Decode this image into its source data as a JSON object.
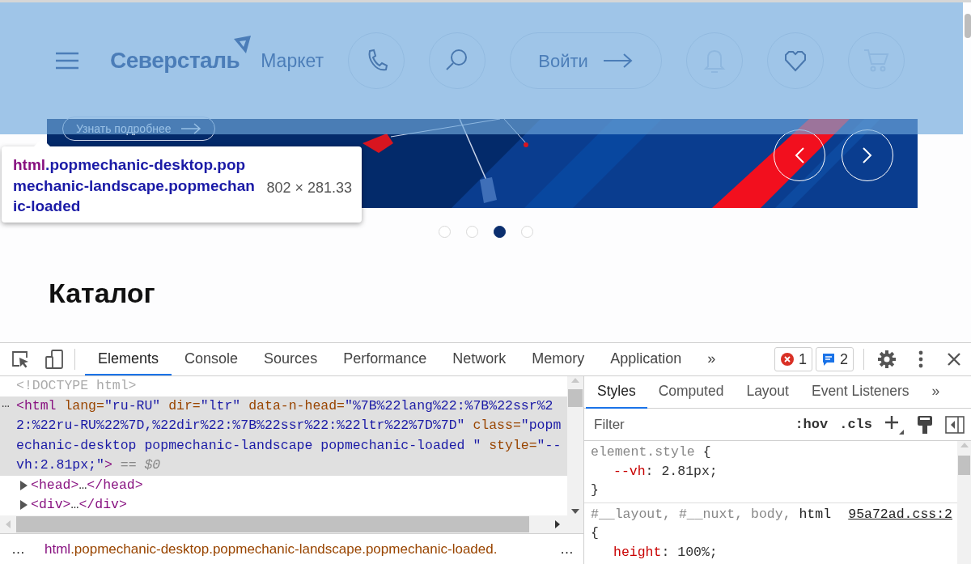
{
  "page": {
    "header": {
      "brand": "Северсталь",
      "product": "Маркет",
      "actions": [
        {
          "kind": "phone",
          "disabled": false
        },
        {
          "kind": "search",
          "disabled": false
        },
        {
          "kind": "login",
          "label": "Войти",
          "disabled": false
        },
        {
          "kind": "bell",
          "disabled": true
        },
        {
          "kind": "heart",
          "disabled": false
        },
        {
          "kind": "cart",
          "disabled": true
        }
      ]
    },
    "banner": {
      "more_button": "Узнать подробнее",
      "dots": [
        {
          "selected": false
        },
        {
          "selected": false
        },
        {
          "selected": true
        },
        {
          "selected": false
        }
      ]
    },
    "catalog_heading": "Каталог",
    "highlight_tooltip": {
      "tag": "html",
      "classes": ".popmechanic-desktop.popmechanic-landscape.popmechanic-loaded",
      "size": "802 × 281.33"
    }
  },
  "devtools": {
    "tabs": [
      {
        "label": "Elements",
        "selected": true
      },
      {
        "label": "Console",
        "selected": false
      },
      {
        "label": "Sources",
        "selected": false
      },
      {
        "label": "Performance",
        "selected": false
      },
      {
        "label": "Network",
        "selected": false
      },
      {
        "label": "Memory",
        "selected": false
      },
      {
        "label": "Application",
        "selected": false
      }
    ],
    "tabs_more": "»",
    "error_count": "1",
    "message_count": "2",
    "dom": [
      {
        "kind": "doctype",
        "tokens": [
          {
            "kind": "comment",
            "text": "<!DOCTYPE html>"
          }
        ]
      },
      {
        "kind": "node",
        "selected": true,
        "gutter": "…",
        "tokens": [
          {
            "kind": "tag",
            "text": "<html"
          },
          {
            "kind": "attr",
            "text": " lang="
          },
          {
            "kind": "val",
            "text": "\"ru-RU\""
          },
          {
            "kind": "attr",
            "text": " dir="
          },
          {
            "kind": "val",
            "text": "\"ltr\""
          },
          {
            "kind": "attr",
            "text": " data-n-head="
          },
          {
            "kind": "val",
            "text": "\"%7B%22lang%22:%7B%22ssr%22:%22ru-RU%22%7D,%22dir%22:%7B%22ssr%22:%22ltr%22%7D%7D\""
          },
          {
            "kind": "attr",
            "text": " class="
          },
          {
            "kind": "val",
            "text": "\"popmechanic-desktop popmechanic-landscape popmechanic-loaded \""
          },
          {
            "kind": "attr",
            "text": " style="
          },
          {
            "kind": "val",
            "text": "\"--vh:2.81px;\""
          },
          {
            "kind": "tag",
            "text": ">"
          },
          {
            "kind": "ref",
            "text": " == $0"
          }
        ]
      },
      {
        "kind": "node",
        "selected": false,
        "expanded": false,
        "tokens": [
          {
            "kind": "tag",
            "text": "<head>"
          },
          {
            "kind": "text",
            "text": "…"
          },
          {
            "kind": "tag",
            "text": "</head>"
          }
        ]
      },
      {
        "kind": "node",
        "selected": false,
        "expanded": false,
        "tokens": [
          {
            "kind": "tag",
            "text": "<div>"
          },
          {
            "kind": "text",
            "text": "…"
          },
          {
            "kind": "tag",
            "text": "</div>"
          }
        ]
      }
    ],
    "breadcrumb_left": "…",
    "breadcrumb": {
      "tag": "html",
      "classes": ".popmechanic-desktop.popmechanic-landscape.popmechanic-loaded."
    },
    "breadcrumb_right": "…",
    "styles": {
      "tabs": [
        {
          "label": "Styles",
          "selected": true
        },
        {
          "label": "Computed",
          "selected": false
        },
        {
          "label": "Layout",
          "selected": false
        },
        {
          "label": "Event Listeners",
          "selected": false
        }
      ],
      "tabs_more": "»",
      "filter": {
        "placeholder": "Filter"
      },
      "hov": ":hov",
      "cls": ".cls",
      "rules": [
        {
          "selector": [
            {
              "text": "element.style",
              "matched": false
            }
          ],
          "open": "{",
          "props": [
            {
              "name": "--vh",
              "colon": ":",
              "value": "2.81px;"
            }
          ],
          "close": "}"
        },
        {
          "selector": [
            {
              "text": "#__layout, #__nuxt, body, ",
              "matched": false
            },
            {
              "text": "html",
              "matched": true
            }
          ],
          "source": "95a72ad.css:2",
          "open": "{",
          "props": [
            {
              "name": "height",
              "colon": ":",
              "value": "100%;"
            }
          ]
        }
      ]
    }
  }
}
